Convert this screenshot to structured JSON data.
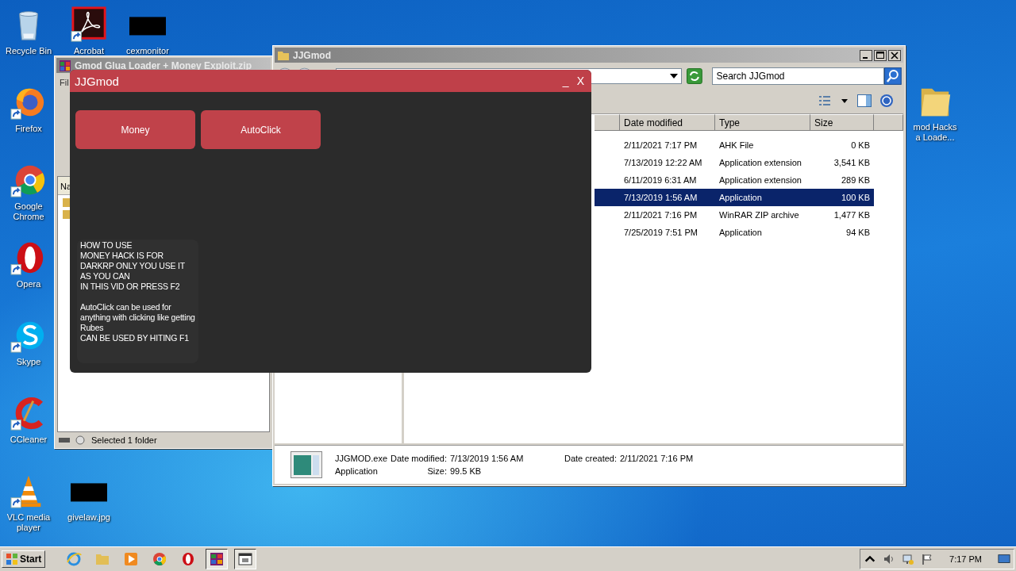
{
  "desktop_icons": [
    {
      "kind": "recycle-bin",
      "label": "Recycle Bin",
      "shortcut": false
    },
    {
      "kind": "acrobat",
      "label": "Acrobat",
      "shortcut": true
    },
    {
      "kind": "blank",
      "label": "cexmonitor",
      "shortcut": false
    },
    {
      "kind": "firefox",
      "label": "Firefox",
      "shortcut": true
    },
    {
      "kind": "chrome",
      "label": "Google\nChrome",
      "shortcut": true
    },
    {
      "kind": "opera",
      "label": "Opera",
      "shortcut": true
    },
    {
      "kind": "skype",
      "label": "Skype",
      "shortcut": true
    },
    {
      "kind": "ccleaner",
      "label": "CCleaner",
      "shortcut": true
    },
    {
      "kind": "vlc",
      "label": "VLC media\nplayer",
      "shortcut": true
    },
    {
      "kind": "blank",
      "label": "givelaw.jpg",
      "shortcut": false
    },
    {
      "kind": "folder",
      "label": "mod Hacks\na Loade...",
      "shortcut": false
    }
  ],
  "winrar_window": {
    "title": "Gmod Glua Loader + Money Exploit.zip",
    "menu": "Fil",
    "column": "Na",
    "status": "Selected 1 folder"
  },
  "explorer": {
    "title": "JJGmod",
    "search": {
      "placeholder": "Search JJGmod"
    },
    "columns": [
      "Date modified",
      "Type",
      "Size"
    ],
    "rows": [
      {
        "date": "2/11/2021 7:17 PM",
        "type": "AHK File",
        "size": "0 KB",
        "selected": false
      },
      {
        "date": "7/13/2019 12:22 AM",
        "type": "Application extension",
        "size": "3,541 KB",
        "selected": false
      },
      {
        "date": "6/11/2019 6:31 AM",
        "type": "Application extension",
        "size": "289 KB",
        "selected": false
      },
      {
        "date": "7/13/2019 1:56 AM",
        "type": "Application",
        "size": "100 KB",
        "selected": true
      },
      {
        "date": "2/11/2021 7:16 PM",
        "type": "WinRAR ZIP archive",
        "size": "1,477 KB",
        "selected": false
      },
      {
        "date": "7/25/2019 7:51 PM",
        "type": "Application",
        "size": "94 KB",
        "selected": false
      }
    ],
    "details": {
      "name": "JJGMOD.exe",
      "type": "Application",
      "modified_label": "Date modified:",
      "modified": "7/13/2019 1:56 AM",
      "size_label": "Size:",
      "size": "99.5 KB",
      "created_label": "Date created:",
      "created": "2/11/2021 7:16 PM"
    }
  },
  "app_window": {
    "title": "JJGmod",
    "minimize": "_",
    "close": "X",
    "buttons": [
      "Money",
      "AutoClick"
    ],
    "instructions": "HOW TO USE\nMONEY HACK IS FOR\nDARKRP ONLY YOU USE IT\nAS YOU CAN\nIN THIS VID OR PRESS F2\n\nAutoClick can be used for\nanything with clicking like getting\nRubes\nCAN BE USED BY HITING F1"
  },
  "taskbar": {
    "start": "Start",
    "clock": "7:17 PM",
    "apps": [
      {
        "kind": "ie",
        "active": false
      },
      {
        "kind": "folder",
        "active": false
      },
      {
        "kind": "media",
        "active": false
      },
      {
        "kind": "chrome",
        "active": false
      },
      {
        "kind": "opera",
        "active": false
      },
      {
        "kind": "winrar",
        "active": true
      },
      {
        "kind": "app",
        "active": true
      }
    ]
  }
}
